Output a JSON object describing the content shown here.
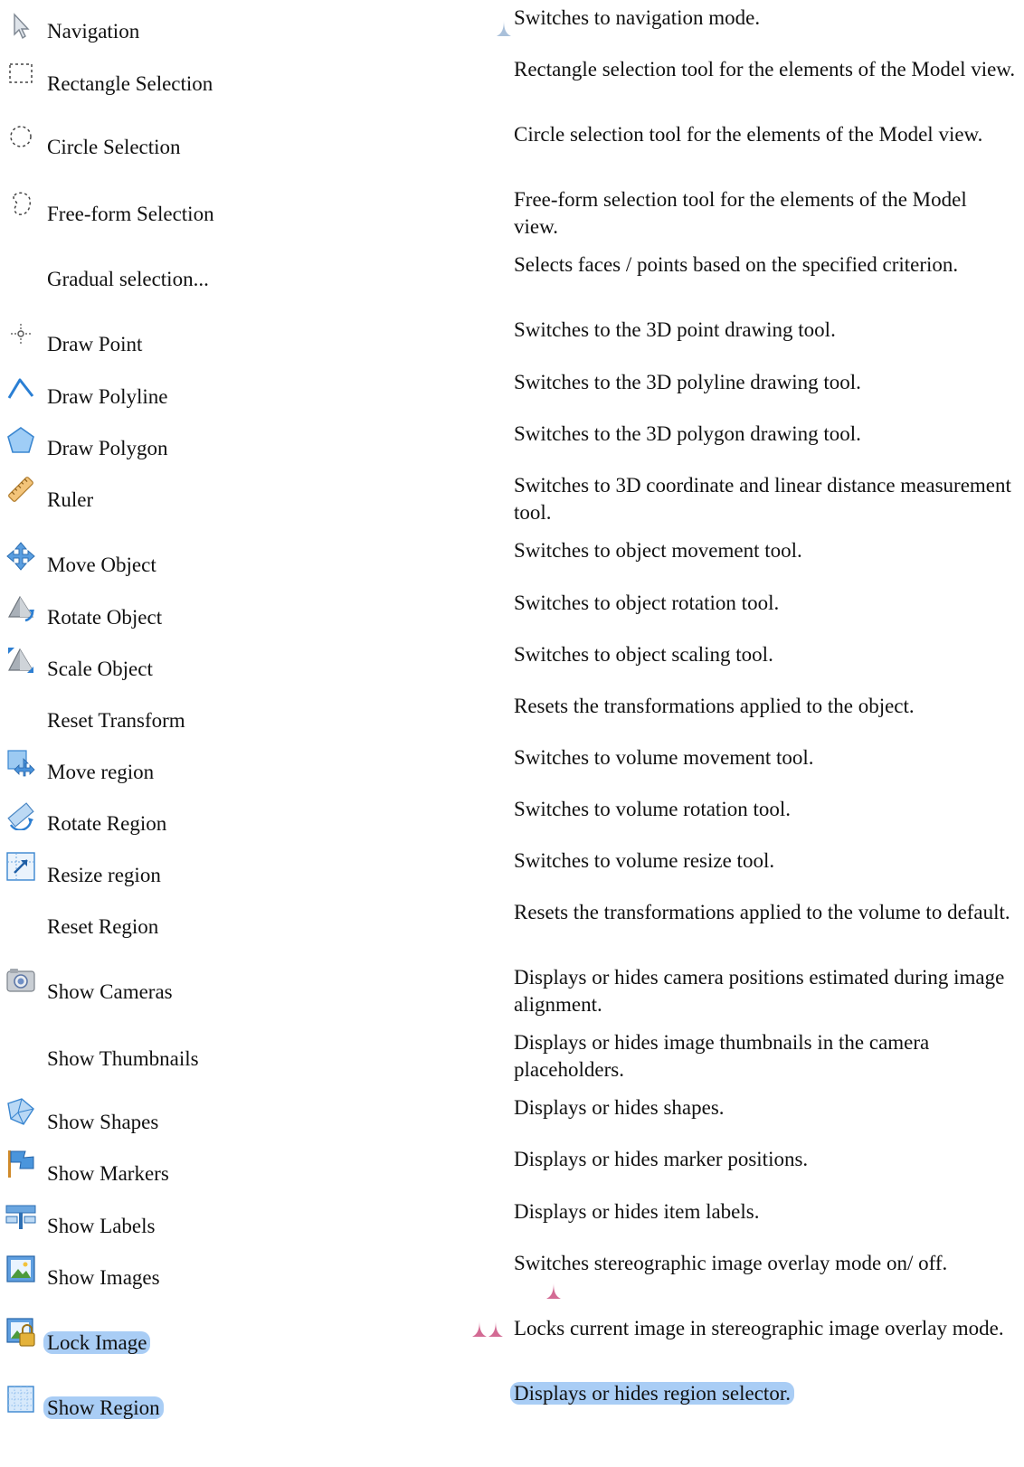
{
  "rows": [
    {
      "name": "Navigation",
      "desc": "Switches to navigation mode.",
      "icon": "navigation-cursor-icon"
    },
    {
      "name": "Rectangle Selection",
      "desc": "Rectangle selection tool for the elements of the Model view.",
      "icon": "rectangle-selection-icon"
    },
    {
      "name": "Circle Selection",
      "desc": "Circle selection tool for the elements of the Model view.",
      "icon": "circle-selection-icon"
    },
    {
      "name": "Free-form Selection",
      "desc": "Free-form selection tool for the elements of the Model view.",
      "icon": "freeform-selection-icon"
    },
    {
      "name": "Gradual selection...",
      "desc": "Selects faces / points based on the specified criterion.",
      "icon": ""
    },
    {
      "name": "Draw Point",
      "desc": "Switches to the 3D point drawing tool.",
      "icon": "draw-point-icon"
    },
    {
      "name": "Draw Polyline",
      "desc": "Switches to the 3D polyline drawing tool.",
      "icon": "draw-polyline-icon"
    },
    {
      "name": "Draw Polygon",
      "desc": "Switches to the 3D polygon drawing tool.",
      "icon": "draw-polygon-icon"
    },
    {
      "name": "Ruler",
      "desc": "Switches to 3D coordinate and linear distance measurement tool.",
      "icon": "ruler-icon"
    },
    {
      "name": "Move Object",
      "desc": "Switches to object movement tool.",
      "icon": "move-object-icon"
    },
    {
      "name": "Rotate Object",
      "desc": "Switches to object rotation tool.",
      "icon": "rotate-object-icon"
    },
    {
      "name": "Scale Object",
      "desc": "Switches to object scaling tool.",
      "icon": "scale-object-icon"
    },
    {
      "name": "Reset Transform",
      "desc": "Resets the transformations applied to the object.",
      "icon": ""
    },
    {
      "name": "Move region",
      "desc": "Switches to volume movement tool.",
      "icon": "move-region-icon"
    },
    {
      "name": "Rotate Region",
      "desc": "Switches to volume rotation tool.",
      "icon": "rotate-region-icon"
    },
    {
      "name": "Resize region",
      "desc": "Switches to volume resize tool.",
      "icon": "resize-region-icon"
    },
    {
      "name": "Reset Region",
      "desc": "Resets the transformations applied to the volume to default.",
      "icon": ""
    },
    {
      "name": "Show Cameras",
      "desc": "Displays or hides camera positions estimated during image alignment.",
      "icon": "camera-icon"
    },
    {
      "name": "Show Thumbnails",
      "desc": "Displays or hides image thumbnails in the camera placeholders.",
      "icon": ""
    },
    {
      "name": "Show Shapes",
      "desc": "Displays or hides shapes.",
      "icon": "shapes-icon"
    },
    {
      "name": "Show Markers",
      "desc": "Displays or hides marker positions.",
      "icon": "marker-flag-icon"
    },
    {
      "name": "Show Labels",
      "desc": "Displays or hides item labels.",
      "icon": "labels-icon"
    },
    {
      "name": "Show Images",
      "desc": "Switches stereographic image overlay mode on/ off.",
      "icon": "image-icon"
    },
    {
      "name": "Lock Image",
      "desc": "Locks current image in stereographic image overlay mode.",
      "icon": "lock-image-icon"
    },
    {
      "name": "Show Region",
      "desc": "Displays or hides region selector.",
      "icon": "region-icon"
    }
  ]
}
